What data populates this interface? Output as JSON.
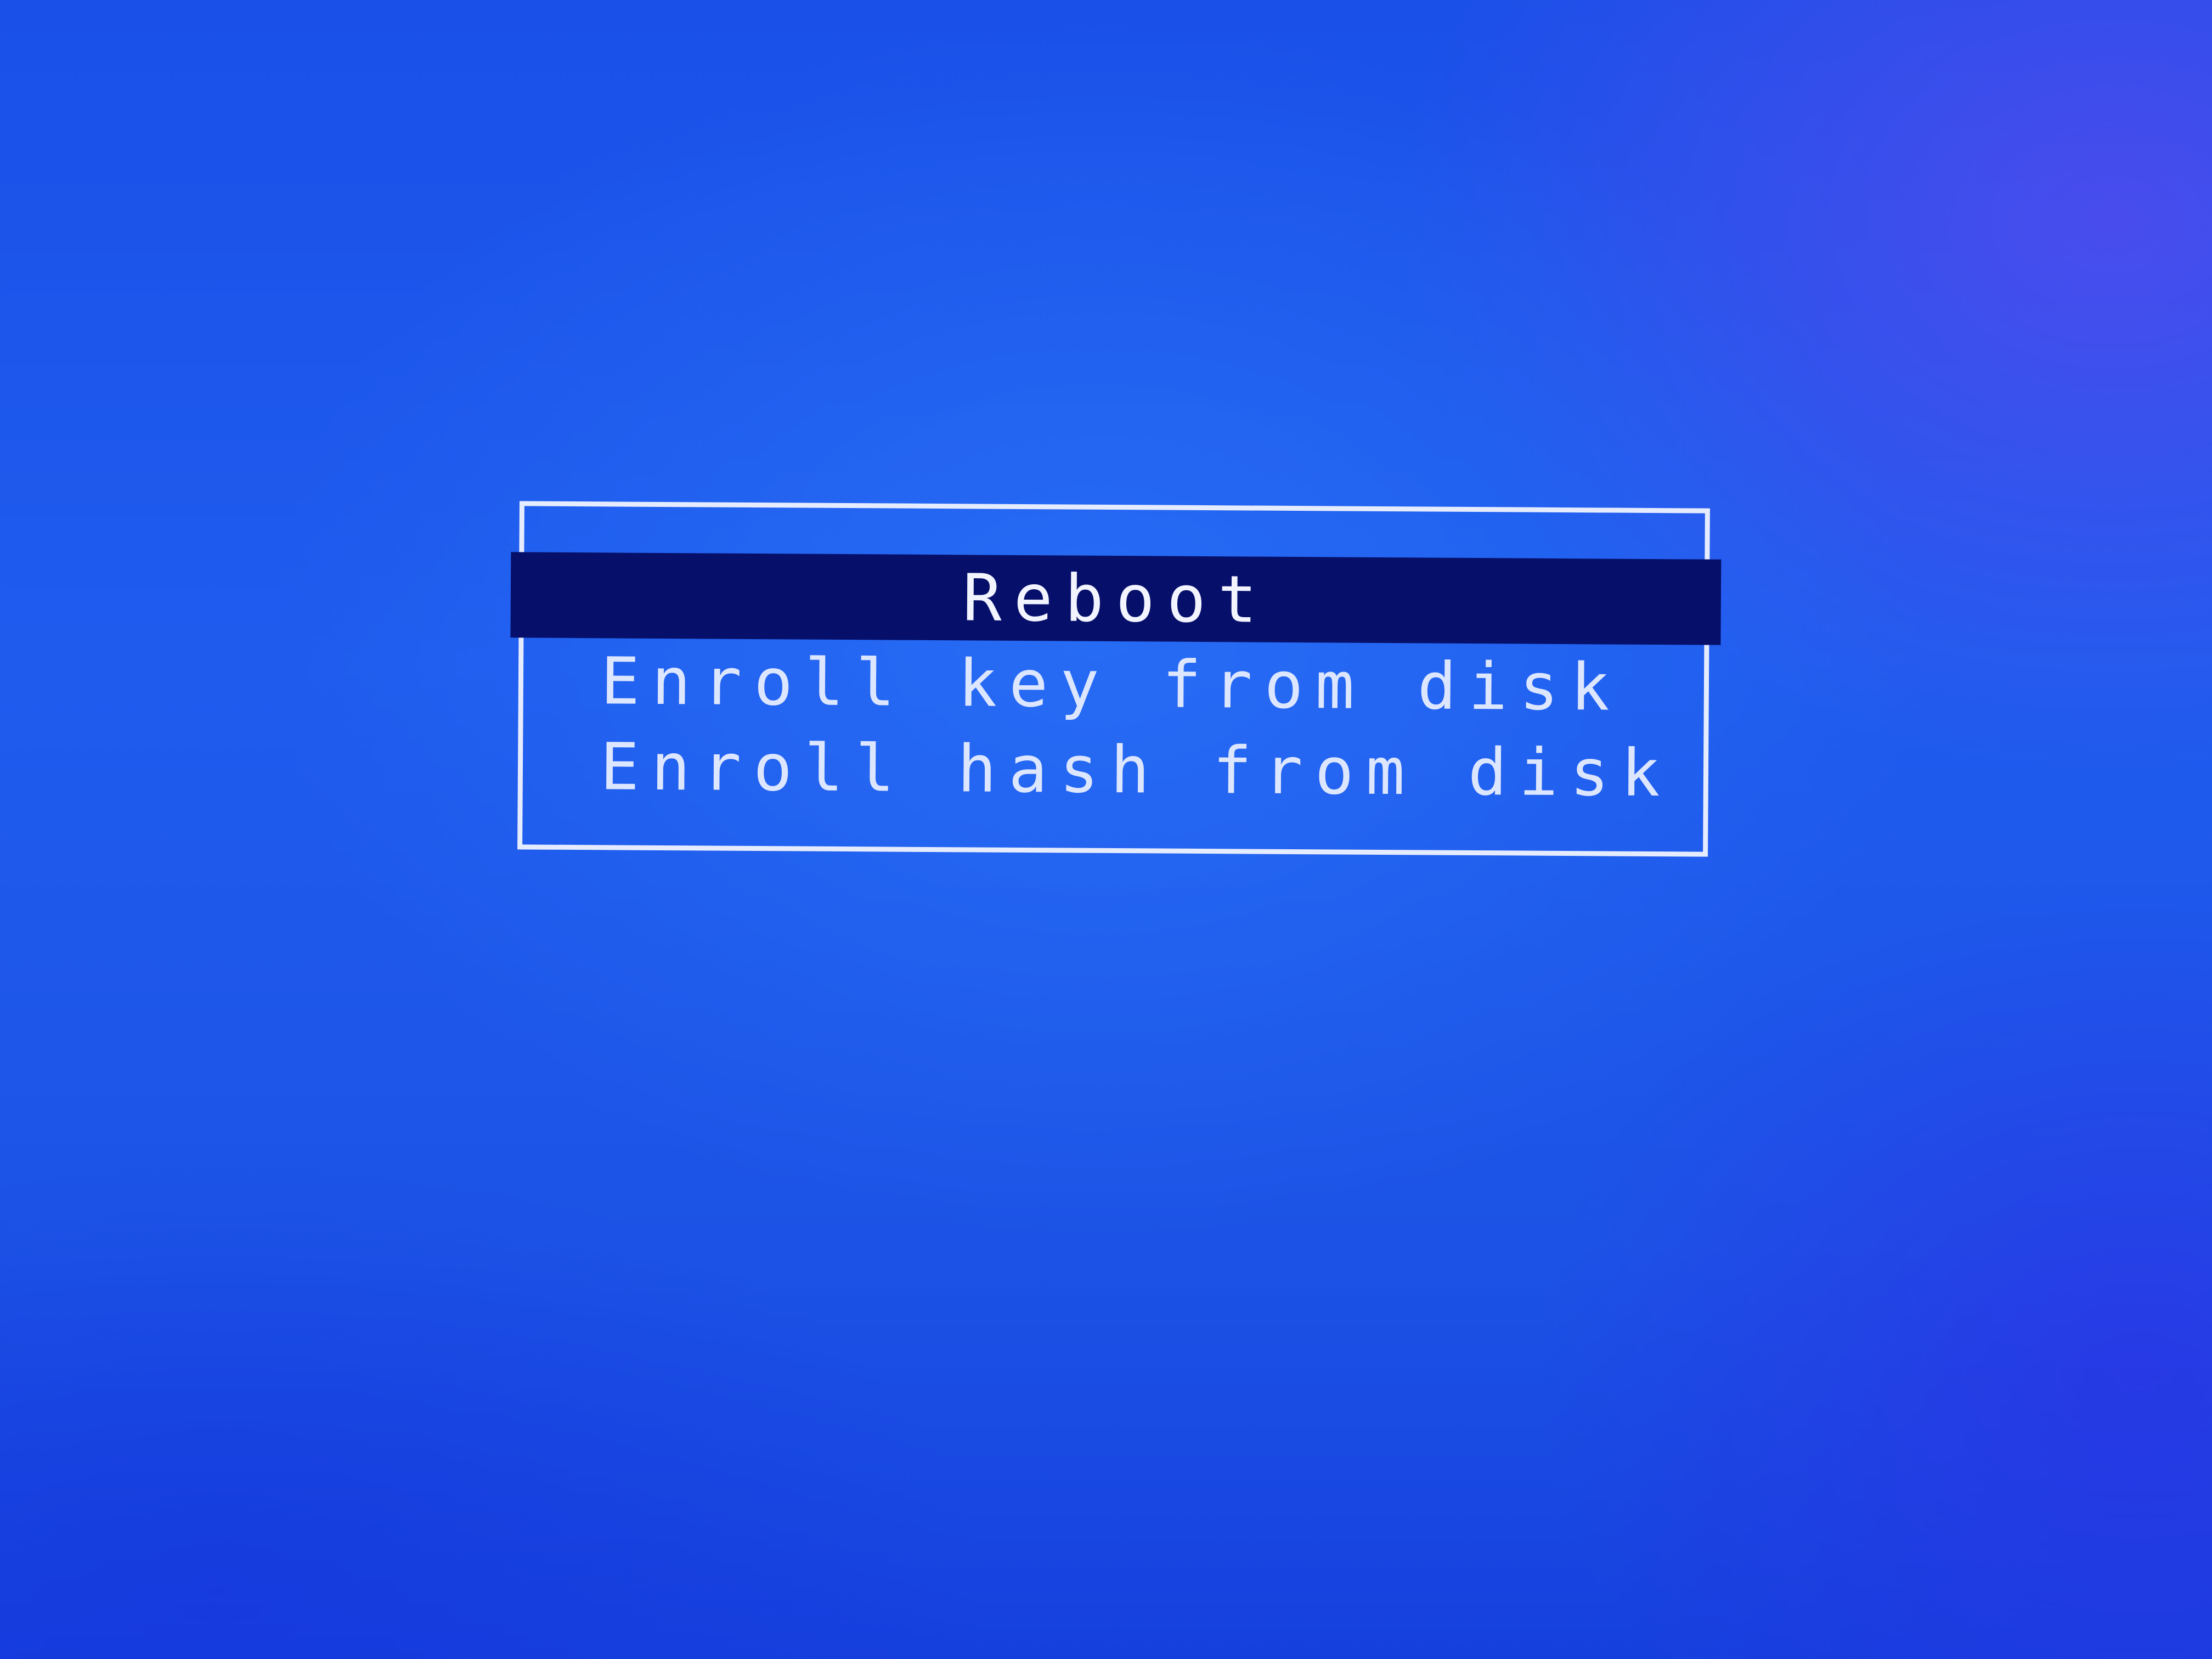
{
  "menu": {
    "items": [
      {
        "label": "Reboot",
        "selected": true
      },
      {
        "label": "Enroll key from disk",
        "selected": false
      },
      {
        "label": "Enroll hash from disk",
        "selected": false
      }
    ]
  },
  "colors": {
    "background": "#1a4fe6",
    "border": "#e6ecff",
    "highlight": "#06106a",
    "text": "#dde6ff"
  }
}
